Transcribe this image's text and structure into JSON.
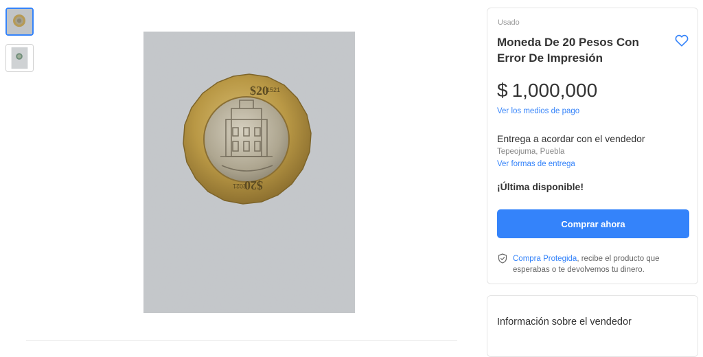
{
  "gallery": {
    "thumbnails": [
      {
        "name": "coin-photo-1",
        "selected": true
      },
      {
        "name": "coin-photo-2",
        "selected": false
      }
    ],
    "coin_engraving": {
      "denomination": "$20",
      "year_left": "1521",
      "year_right": "2021"
    }
  },
  "product": {
    "condition": "Usado",
    "title": "Moneda De 20 Pesos Con Error De Impresión",
    "price_symbol": "$",
    "price": "1,000,000",
    "payment_link": "Ver los medios de pago",
    "delivery": "Entrega a acordar con el vendedor",
    "location": "Tepeojuma, Puebla",
    "delivery_link": "Ver formas de entrega",
    "stock": "¡Última disponible!",
    "buy_button": "Comprar ahora",
    "protected_link": "Compra Protegida",
    "protected_text": ", recibe el producto que esperabas o te devolvemos tu dinero."
  },
  "seller": {
    "title": "Información sobre el vendedor"
  },
  "icons": {
    "favorite": "heart-icon",
    "protection": "shield-check-icon"
  },
  "colors": {
    "accent": "#3483fa",
    "text": "#333333",
    "muted": "#999999"
  }
}
